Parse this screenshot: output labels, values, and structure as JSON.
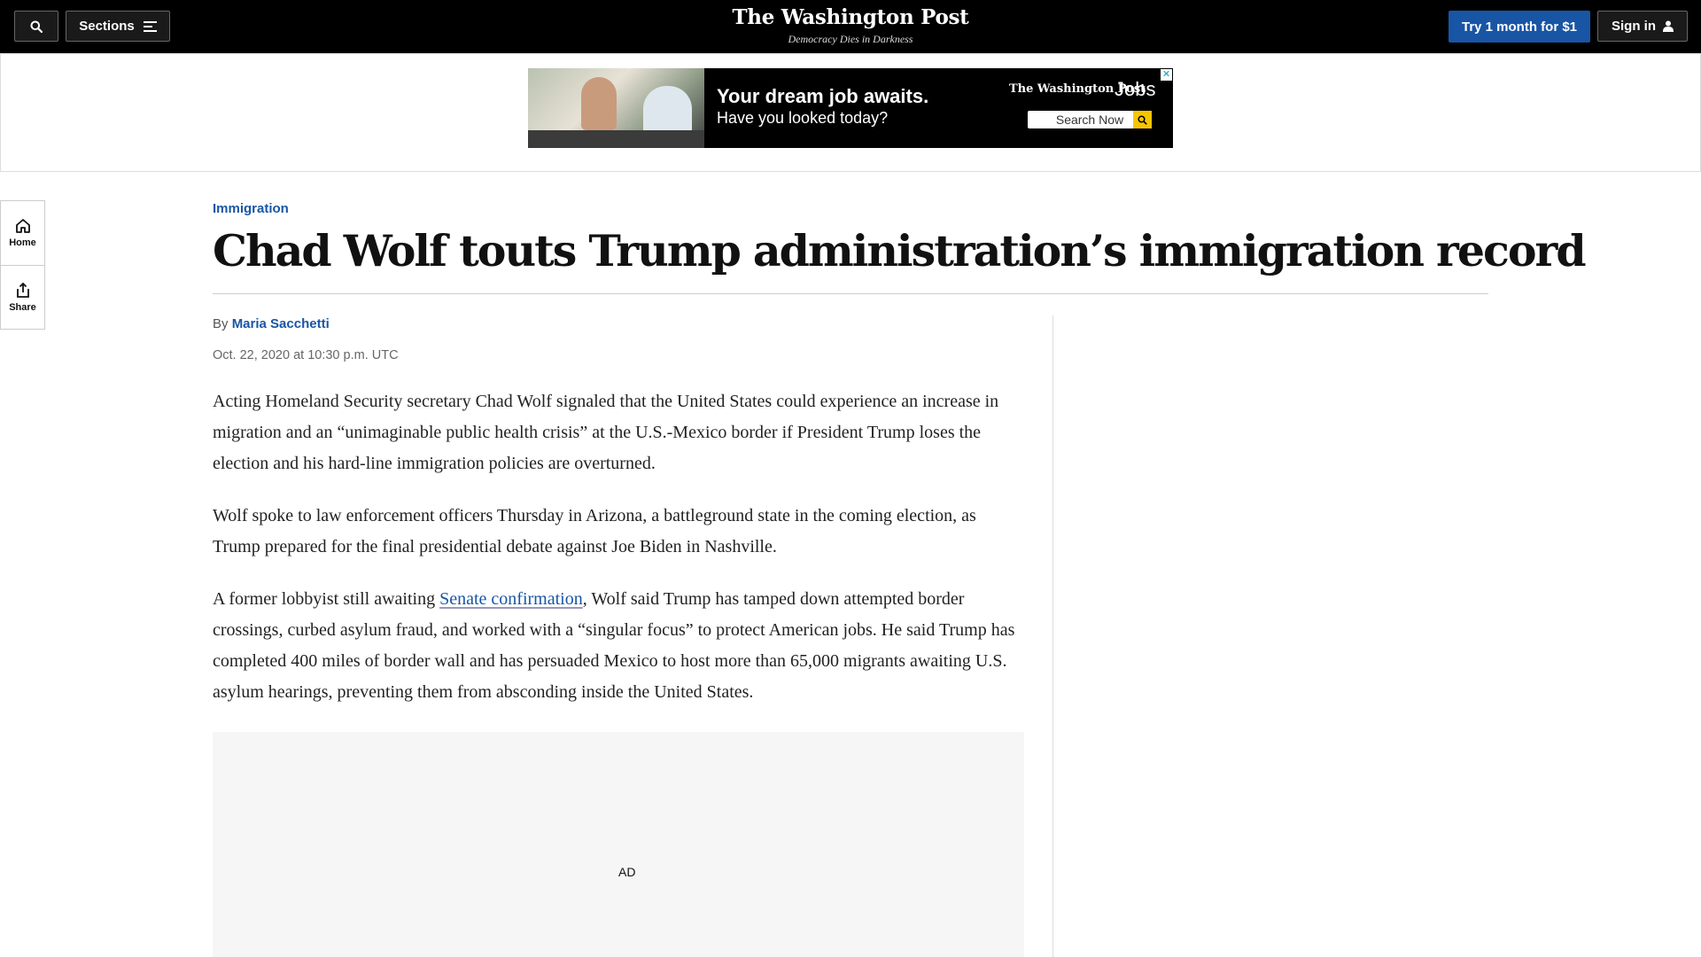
{
  "header": {
    "sections_label": "Sections",
    "logo": "The Washington Post",
    "tagline": "Democracy Dies in Darkness",
    "subscribe_label": "Try 1 month for $1",
    "signin_label": "Sign in"
  },
  "banner_ad": {
    "headline": "Your dream job awaits.",
    "subline": "Have you looked today?",
    "brand": "The Washington Post",
    "product": "Jobs",
    "search_label": "Search Now",
    "close_glyph": "✕"
  },
  "left_rail": {
    "items": [
      {
        "label": "Home",
        "icon": "home-icon"
      },
      {
        "label": "Share",
        "icon": "share-icon"
      }
    ]
  },
  "article": {
    "kicker": "Immigration",
    "headline": "Chad Wolf touts Trump administration’s immigration record",
    "byline_prefix": "By ",
    "author": "Maria Sacchetti",
    "date": "Oct. 22, 2020 at 10:30 p.m. UTC",
    "p1": "Acting Homeland Security secretary Chad Wolf signaled that the United States could experience an increase in migration and an “unimaginable public health crisis” at the U.S.-Mexico border if President Trump loses the election and his hard-line immigration policies are overturned.",
    "p2": "Wolf spoke to law enforcement officers Thursday in Arizona, a battleground state in the coming election, as Trump prepared for the final presidential debate against Joe Biden in Nashville.",
    "p3_before": "A former lobbyist still awaiting ",
    "p3_link": "Senate confirmation",
    "p3_after": ", Wolf said Trump has tamped down attempted border crossings, curbed asylum fraud, and worked with a “singular focus” to protect American jobs. He said Trump has completed 400 miles of border wall and has persuaded Mexico to host more than 65,000 migrants awaiting U.S. asylum hearings, preventing them from absconding inside the United States."
  },
  "inline_ad": {
    "label": "AD"
  },
  "colors": {
    "accent": "#1955a5",
    "topbar": "#000000",
    "ad_bg": "#f6f6f6"
  }
}
